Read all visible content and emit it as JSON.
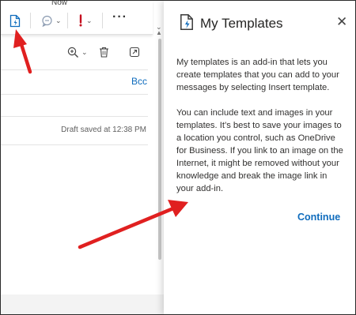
{
  "toolbar": {
    "now_label": "Now",
    "more_label": "···"
  },
  "compose": {
    "bcc_label": "Bcc",
    "draft_status": "Draft saved at 12:38 PM"
  },
  "panel": {
    "title": "My Templates",
    "paragraph1": "My templates is an add-in that lets you create templates that you can add to your messages by selecting Insert template.",
    "paragraph2": "You can include text and images in your templates. It’s best to save your images to a location you control, such as OneDrive for Business. If you link to an image on the Internet, it might be removed without your knowledge and break the image link in your add-in.",
    "continue_label": "Continue"
  },
  "colors": {
    "accent": "#0f6cbd",
    "annotation": "#e02020",
    "importance": "#c50f1f"
  }
}
